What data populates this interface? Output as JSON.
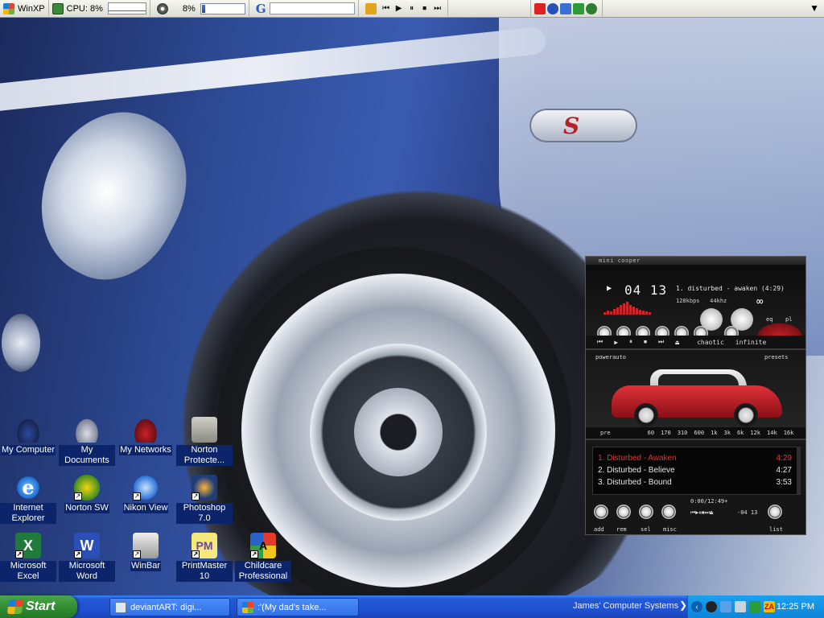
{
  "topbar": {
    "os_label": "WinXP",
    "cpu_label": "CPU: 8%",
    "disk_label": "8%",
    "disk_fill_percent": 8,
    "google_logo": "G",
    "media_buttons": [
      "⏮",
      "▶",
      "⏸",
      "⏹",
      "⏭"
    ]
  },
  "desktop_icons": [
    {
      "id": "my-computer",
      "label": "My Computer",
      "icon": "car-icon",
      "shortcut": false
    },
    {
      "id": "my-documents",
      "label": "My Documents",
      "icon": "car-icon",
      "shortcut": false
    },
    {
      "id": "my-networks",
      "label": "My Networks",
      "icon": "car-icon",
      "shortcut": false
    },
    {
      "id": "norton-protected",
      "label": "Norton Protecte...",
      "icon": "norton-icon",
      "shortcut": false
    },
    {
      "id": "internet-explorer",
      "label": "Internet Explorer",
      "icon": "ie-icon",
      "shortcut": false
    },
    {
      "id": "norton-sw",
      "label": "Norton SW",
      "icon": "norton-sw-icon",
      "shortcut": true
    },
    {
      "id": "nikon-view",
      "label": "Nikon View",
      "icon": "nikon-icon",
      "shortcut": true
    },
    {
      "id": "photoshop",
      "label": "Photoshop 7.0",
      "icon": "photoshop-icon",
      "shortcut": true
    },
    {
      "id": "microsoft-excel",
      "label": "Microsoft Excel",
      "icon": "excel-icon",
      "shortcut": true
    },
    {
      "id": "microsoft-word",
      "label": "Microsoft Word",
      "icon": "word-icon",
      "shortcut": true
    },
    {
      "id": "winbar",
      "label": "WinBar",
      "icon": "winbar-icon",
      "shortcut": true
    },
    {
      "id": "printmaster",
      "label": "PrintMaster 10",
      "icon": "printmaster-icon",
      "shortcut": true
    },
    {
      "id": "childcare-professional",
      "label": "Childcare Professional",
      "icon": "childcare-icon",
      "shortcut": true
    }
  ],
  "winamp": {
    "title": "mini cooper",
    "time": "04 13",
    "track_display": "1. disturbed - awaken (4:29)",
    "bitrate": "128kbps",
    "samplerate": "44khz",
    "eq_label": "eq",
    "pl_label": "pl",
    "controls": [
      "⏮",
      "▶",
      "⏸",
      "⏹",
      "⏭",
      "⏏"
    ],
    "chaotic_label": "chaotic",
    "infinite_label": "infinite",
    "power_label": "power",
    "auto_label": "auto",
    "presets_label": "presets",
    "pre_label": "pre",
    "eq_freqs": [
      "60",
      "170",
      "310",
      "600",
      "1k",
      "3k",
      "6k",
      "12k",
      "14k",
      "16k"
    ],
    "playlist": [
      {
        "title": "1. Disturbed - Awaken",
        "duration": "4:29",
        "active": true
      },
      {
        "title": "2. Disturbed - Believe",
        "duration": "4:27",
        "active": false
      },
      {
        "title": "3. Disturbed - Bound",
        "duration": "3:53",
        "active": false
      }
    ],
    "playlist_total": "0:00/12:49+",
    "playlist_time": "-04 13",
    "playlist_buttons": [
      "add",
      "rem",
      "sel",
      "misc",
      "list"
    ]
  },
  "taskbar": {
    "start_label": "Start",
    "tasks": [
      {
        "label": "deviantART: digi...",
        "icon": "browser-icon"
      },
      {
        "label": ":'(My dad's take...",
        "icon": "messenger-icon"
      }
    ],
    "toolbar_label": "James' Computer Systems",
    "clock": "12:25 PM"
  },
  "colors": {
    "xp_blue": "#2459d6",
    "start_green": "#2f8a2f",
    "tray_blue": "#0f85d8",
    "winamp_accent": "#e23532"
  }
}
